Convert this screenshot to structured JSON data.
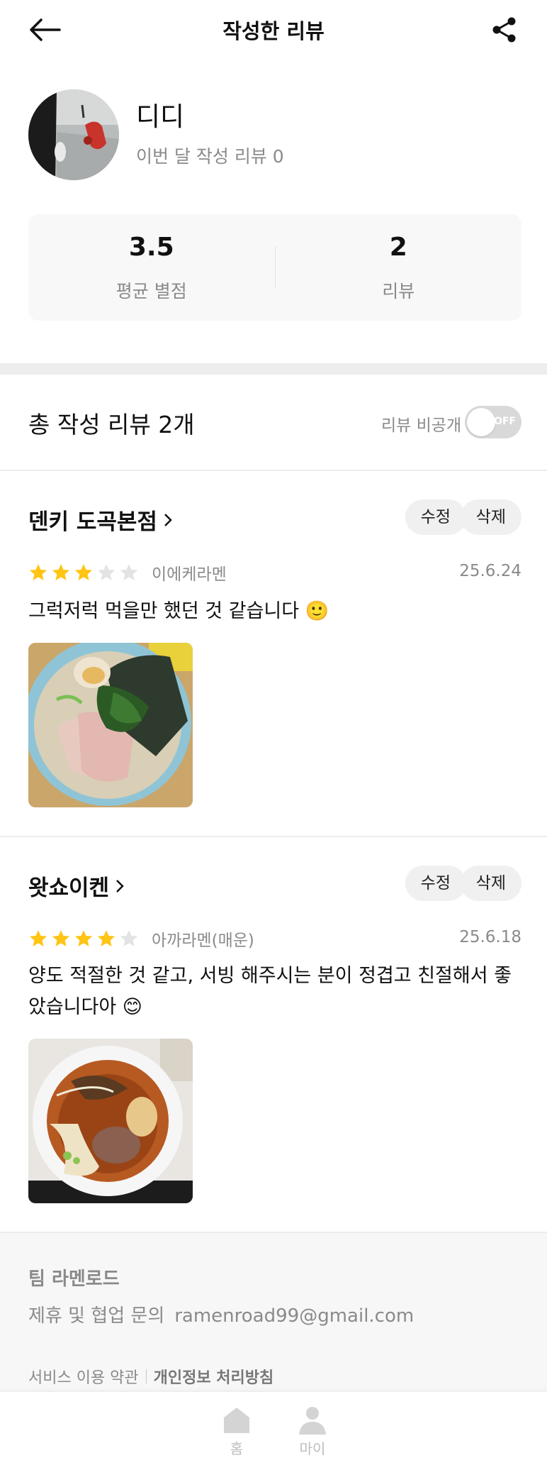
{
  "header": {
    "title": "작성한 리뷰",
    "back_icon": "arrow-left-icon",
    "share_icon": "share-icon"
  },
  "profile": {
    "nickname": "디디",
    "month_reviews_label": "이번 달 작성 리뷰 0"
  },
  "stats": {
    "avg_rating": "3.5",
    "avg_rating_label": "평균 별점",
    "review_count": "2",
    "review_count_label": "리뷰"
  },
  "summary": {
    "total_label": "총 작성 리뷰 2개",
    "private_label": "리뷰 비공개",
    "toggle_text": "OFF"
  },
  "reviews": [
    {
      "store": "덴키 도곡본점",
      "edit": "수정",
      "delete": "삭제",
      "rating": 3,
      "menu": "이에케라멘",
      "date": "25.6.24",
      "content": "그럭저럭 먹을만 했던 것 같습니다 🙂"
    },
    {
      "store": "왓쇼이켄",
      "edit": "수정",
      "delete": "삭제",
      "rating": 4,
      "menu": "아까라멘(매운)",
      "date": "25.6.18",
      "content": "양도 적절한 것 같고, 서빙 해주시는 분이 정겹고 친절해서 좋았습니다아 😊"
    }
  ],
  "footer": {
    "team": "팀 라멘로드",
    "contact_label": "제휴 및 협업 문의",
    "email": "ramenroad99@gmail.com",
    "terms": "서비스 이용 약관",
    "privacy": "개인정보 처리방침"
  },
  "nav": {
    "home": "홈",
    "my": "마이"
  },
  "colors": {
    "star_on": "#FFC414",
    "star_off": "#E3E3E3",
    "text_gray": "#8a8a8a"
  }
}
